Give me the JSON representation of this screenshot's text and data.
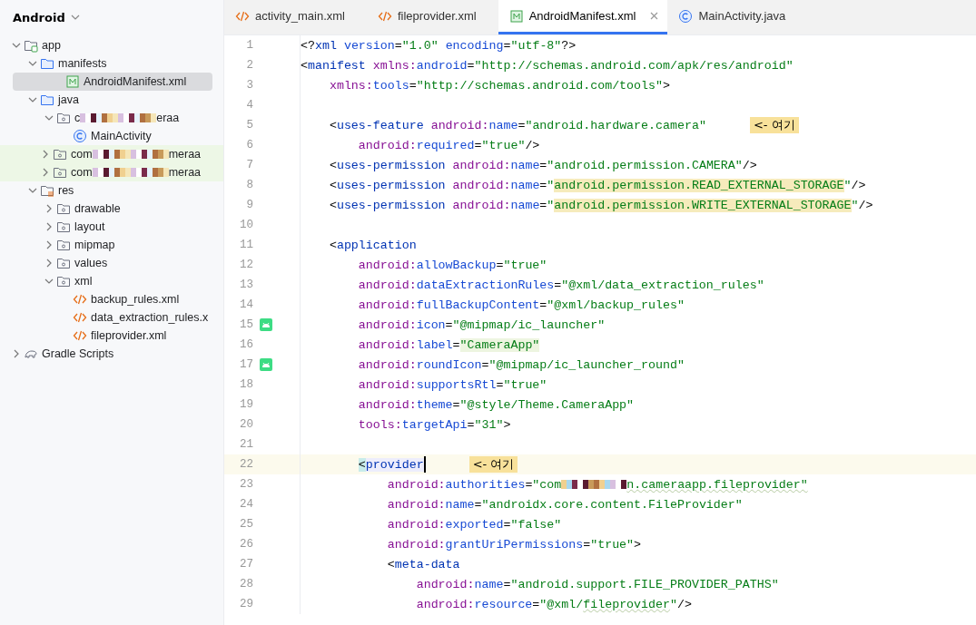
{
  "project_view": {
    "title": "Android",
    "tree": [
      {
        "kind": "module",
        "label": "app",
        "expanded": true,
        "selected": false,
        "highlighted": false,
        "children": [
          {
            "kind": "source-folder",
            "label": "manifests",
            "expanded": true,
            "selected": false,
            "highlighted": false,
            "children": [
              {
                "kind": "manifest",
                "label": "AndroidManifest.xml",
                "selected": true,
                "highlighted": false
              }
            ]
          },
          {
            "kind": "source-folder",
            "label": "java",
            "expanded": true,
            "selected": false,
            "highlighted": false,
            "children": [
              {
                "kind": "package",
                "label": "c",
                "label_end": "eraa",
                "redacted": true,
                "expanded": true,
                "selected": false,
                "highlighted": false,
                "children": [
                  {
                    "kind": "class",
                    "label": "MainActivity",
                    "selected": false,
                    "highlighted": false
                  }
                ]
              },
              {
                "kind": "package",
                "label": "com",
                "label_end": "meraa",
                "redacted": true,
                "expanded": false,
                "selected": false,
                "highlighted": true
              },
              {
                "kind": "package",
                "label": "com",
                "label_end": "meraa",
                "redacted": true,
                "expanded": false,
                "selected": false,
                "highlighted": true
              }
            ]
          },
          {
            "kind": "res-folder",
            "label": "res",
            "expanded": true,
            "selected": false,
            "highlighted": false,
            "children": [
              {
                "kind": "package",
                "label": "drawable",
                "expanded": false,
                "selected": false,
                "highlighted": false
              },
              {
                "kind": "package",
                "label": "layout",
                "expanded": false,
                "selected": false,
                "highlighted": false
              },
              {
                "kind": "package",
                "label": "mipmap",
                "expanded": false,
                "selected": false,
                "highlighted": false
              },
              {
                "kind": "package",
                "label": "values",
                "expanded": false,
                "selected": false,
                "highlighted": false
              },
              {
                "kind": "package",
                "label": "xml",
                "expanded": true,
                "selected": false,
                "highlighted": false,
                "children": [
                  {
                    "kind": "xml",
                    "label": "backup_rules.xml",
                    "selected": false,
                    "highlighted": false
                  },
                  {
                    "kind": "xml",
                    "label": "data_extraction_rules.x",
                    "selected": false,
                    "highlighted": false
                  },
                  {
                    "kind": "xml",
                    "label": "fileprovider.xml",
                    "selected": false,
                    "highlighted": false
                  }
                ]
              }
            ]
          }
        ]
      },
      {
        "kind": "gradle",
        "label": "Gradle Scripts",
        "expanded": false,
        "selected": false,
        "highlighted": false
      }
    ]
  },
  "tabs": [
    {
      "kind": "xml",
      "label": "activity_main.xml",
      "selected": false
    },
    {
      "kind": "xml",
      "label": "fileprovider.xml",
      "selected": false
    },
    {
      "kind": "manifest",
      "label": "AndroidManifest.xml",
      "selected": true
    },
    {
      "kind": "class",
      "label": "MainActivity.java",
      "selected": false
    }
  ],
  "editor": {
    "lines": [
      {
        "number": "1",
        "current": false,
        "segments": [
          {
            "kind": "punct",
            "t": "<?"
          },
          {
            "kind": "tag",
            "t": "xml"
          },
          {
            "kind": "attr",
            "t": " version"
          },
          {
            "kind": "punct",
            "t": "="
          },
          {
            "kind": "value",
            "t": "\"1.0\""
          },
          {
            "kind": "attr",
            "t": " encoding"
          },
          {
            "kind": "punct",
            "t": "="
          },
          {
            "kind": "value",
            "t": "\"utf-8\""
          },
          {
            "kind": "punct",
            "t": "?>"
          }
        ]
      },
      {
        "number": "2",
        "current": false,
        "segments": [
          {
            "kind": "punct",
            "t": "<"
          },
          {
            "kind": "tag",
            "t": "manifest"
          },
          {
            "kind": "prefix",
            "t": " xmlns:"
          },
          {
            "kind": "attr",
            "t": "android"
          },
          {
            "kind": "punct",
            "t": "="
          },
          {
            "kind": "value",
            "t": "\"http://schemas.android.com/apk/res/android\""
          }
        ]
      },
      {
        "number": "3",
        "current": false,
        "segments": [
          {
            "kind": "prefix",
            "t": "    xmlns:"
          },
          {
            "kind": "attr",
            "t": "tools"
          },
          {
            "kind": "punct",
            "t": "="
          },
          {
            "kind": "value",
            "t": "\"http://schemas.android.com/tools\""
          },
          {
            "kind": "punct",
            "t": ">"
          }
        ]
      },
      {
        "number": "4",
        "current": false
      },
      {
        "number": "5",
        "current": false,
        "note": "<- 여기",
        "segments": [
          {
            "kind": "punct",
            "t": "    <"
          },
          {
            "kind": "tag",
            "t": "uses-feature"
          },
          {
            "kind": "prefix",
            "t": " android:"
          },
          {
            "kind": "attr",
            "t": "name"
          },
          {
            "kind": "punct",
            "t": "="
          },
          {
            "kind": "value",
            "t": "\"android.hardware.camera\""
          }
        ]
      },
      {
        "number": "6",
        "current": false,
        "segments": [
          {
            "kind": "prefix",
            "t": "        android:"
          },
          {
            "kind": "attr",
            "t": "required"
          },
          {
            "kind": "punct",
            "t": "="
          },
          {
            "kind": "value",
            "t": "\"true\""
          },
          {
            "kind": "punct",
            "t": "/>"
          }
        ]
      },
      {
        "number": "7",
        "current": false,
        "segments": [
          {
            "kind": "punct",
            "t": "    <"
          },
          {
            "kind": "tag",
            "t": "uses-permission"
          },
          {
            "kind": "prefix",
            "t": " android:"
          },
          {
            "kind": "attr",
            "t": "name"
          },
          {
            "kind": "punct",
            "t": "="
          },
          {
            "kind": "value",
            "t": "\"android.permission.CAMERA\""
          },
          {
            "kind": "punct",
            "t": "/>"
          }
        ]
      },
      {
        "number": "8",
        "current": false,
        "segments": [
          {
            "kind": "punct",
            "t": "    <"
          },
          {
            "kind": "tag",
            "t": "uses-permission"
          },
          {
            "kind": "prefix",
            "t": " android:"
          },
          {
            "kind": "attr",
            "t": "name"
          },
          {
            "kind": "punct",
            "t": "="
          },
          {
            "kind": "value",
            "t": "\""
          },
          {
            "kind": "value",
            "t": "android.permission.READ_EXTERNAL_STORAGE",
            "warning": true
          },
          {
            "kind": "value",
            "t": "\""
          },
          {
            "kind": "punct",
            "t": "/>"
          }
        ]
      },
      {
        "number": "9",
        "current": false,
        "segments": [
          {
            "kind": "punct",
            "t": "    <"
          },
          {
            "kind": "tag",
            "t": "uses-permission"
          },
          {
            "kind": "prefix",
            "t": " android:"
          },
          {
            "kind": "attr",
            "t": "name"
          },
          {
            "kind": "punct",
            "t": "="
          },
          {
            "kind": "value",
            "t": "\""
          },
          {
            "kind": "value",
            "t": "android.permission.WRITE_EXTERNAL_STORAGE",
            "warning": true
          },
          {
            "kind": "value",
            "t": "\""
          },
          {
            "kind": "punct",
            "t": "/>"
          }
        ]
      },
      {
        "number": "10",
        "current": false
      },
      {
        "number": "11",
        "current": false,
        "segments": [
          {
            "kind": "punct",
            "t": "    <"
          },
          {
            "kind": "tag",
            "t": "application"
          }
        ]
      },
      {
        "number": "12",
        "current": false,
        "segments": [
          {
            "kind": "prefix",
            "t": "        android:"
          },
          {
            "kind": "attr",
            "t": "allowBackup"
          },
          {
            "kind": "punct",
            "t": "="
          },
          {
            "kind": "value",
            "t": "\"true\""
          }
        ]
      },
      {
        "number": "13",
        "current": false,
        "segments": [
          {
            "kind": "prefix",
            "t": "        android:"
          },
          {
            "kind": "attr",
            "t": "dataExtractionRules"
          },
          {
            "kind": "punct",
            "t": "="
          },
          {
            "kind": "value",
            "t": "\"@xml/data_extraction_rules\""
          }
        ]
      },
      {
        "number": "14",
        "current": false,
        "segments": [
          {
            "kind": "prefix",
            "t": "        android:"
          },
          {
            "kind": "attr",
            "t": "fullBackupContent"
          },
          {
            "kind": "punct",
            "t": "="
          },
          {
            "kind": "value",
            "t": "\"@xml/backup_rules\""
          }
        ]
      },
      {
        "number": "15",
        "current": false,
        "android_icon": true,
        "segments": [
          {
            "kind": "prefix",
            "t": "        android:"
          },
          {
            "kind": "attr",
            "t": "icon"
          },
          {
            "kind": "punct",
            "t": "="
          },
          {
            "kind": "value",
            "t": "\"@mipmap/ic_launcher\""
          }
        ]
      },
      {
        "number": "16",
        "current": false,
        "segments": [
          {
            "kind": "prefix",
            "t": "        android:"
          },
          {
            "kind": "attr",
            "t": "label"
          },
          {
            "kind": "punct",
            "t": "="
          },
          {
            "kind": "value",
            "t": "\"CameraApp\"",
            "usage_highlight": true
          }
        ]
      },
      {
        "number": "17",
        "current": false,
        "android_icon": true,
        "segments": [
          {
            "kind": "prefix",
            "t": "        android:"
          },
          {
            "kind": "attr",
            "t": "roundIcon"
          },
          {
            "kind": "punct",
            "t": "="
          },
          {
            "kind": "value",
            "t": "\"@mipmap/ic_launcher_round\""
          }
        ]
      },
      {
        "number": "18",
        "current": false,
        "segments": [
          {
            "kind": "prefix",
            "t": "        android:"
          },
          {
            "kind": "attr",
            "t": "supportsRtl"
          },
          {
            "kind": "punct",
            "t": "="
          },
          {
            "kind": "value",
            "t": "\"true\""
          }
        ]
      },
      {
        "number": "19",
        "current": false,
        "segments": [
          {
            "kind": "prefix",
            "t": "        android:"
          },
          {
            "kind": "attr",
            "t": "theme"
          },
          {
            "kind": "punct",
            "t": "="
          },
          {
            "kind": "value",
            "t": "\"@style/Theme.CameraApp\""
          }
        ]
      },
      {
        "number": "20",
        "current": false,
        "segments": [
          {
            "kind": "prefix",
            "t": "        tools:"
          },
          {
            "kind": "attr",
            "t": "targetApi"
          },
          {
            "kind": "punct",
            "t": "="
          },
          {
            "kind": "value",
            "t": "\"31\""
          },
          {
            "kind": "punct",
            "t": ">"
          }
        ]
      },
      {
        "number": "21",
        "current": false
      },
      {
        "number": "22",
        "current": true,
        "note": "<- 여기",
        "segments": [
          {
            "kind": "punct",
            "t": "        <",
            "brace_match": true
          },
          {
            "kind": "tag",
            "t": "provider",
            "tag_match": true
          }
        ]
      },
      {
        "number": "23",
        "current": false,
        "segments": [
          {
            "kind": "prefix",
            "t": "            android:"
          },
          {
            "kind": "attr",
            "t": "authorities"
          },
          {
            "kind": "punct",
            "t": "="
          },
          {
            "kind": "value",
            "t": "\"com"
          },
          {
            "kind": "redacted"
          },
          {
            "kind": "value",
            "t": "n.cameraapp.fileprovider\"",
            "squiggle": true
          }
        ]
      },
      {
        "number": "24",
        "current": false,
        "segments": [
          {
            "kind": "prefix",
            "t": "            android:"
          },
          {
            "kind": "attr",
            "t": "name"
          },
          {
            "kind": "punct",
            "t": "="
          },
          {
            "kind": "value",
            "t": "\"androidx.core.content.FileProvider\""
          }
        ]
      },
      {
        "number": "25",
        "current": false,
        "segments": [
          {
            "kind": "prefix",
            "t": "            android:"
          },
          {
            "kind": "attr",
            "t": "exported"
          },
          {
            "kind": "punct",
            "t": "="
          },
          {
            "kind": "value",
            "t": "\"false\""
          }
        ]
      },
      {
        "number": "26",
        "current": false,
        "segments": [
          {
            "kind": "prefix",
            "t": "            android:"
          },
          {
            "kind": "attr",
            "t": "grantUriPermissions"
          },
          {
            "kind": "punct",
            "t": "="
          },
          {
            "kind": "value",
            "t": "\"true\""
          },
          {
            "kind": "punct",
            "t": ">"
          }
        ]
      },
      {
        "number": "27",
        "current": false,
        "segments": [
          {
            "kind": "punct",
            "t": "            <"
          },
          {
            "kind": "tag",
            "t": "meta-data"
          }
        ]
      },
      {
        "number": "28",
        "current": false,
        "segments": [
          {
            "kind": "prefix",
            "t": "                android:"
          },
          {
            "kind": "attr",
            "t": "name"
          },
          {
            "kind": "punct",
            "t": "="
          },
          {
            "kind": "value",
            "t": "\"android.support.FILE_PROVIDER_PATHS\""
          }
        ]
      },
      {
        "number": "29",
        "current": false,
        "segments": [
          {
            "kind": "prefix",
            "t": "                android:"
          },
          {
            "kind": "attr",
            "t": "resource"
          },
          {
            "kind": "punct",
            "t": "="
          },
          {
            "kind": "value",
            "t": "\"@xml/"
          },
          {
            "kind": "value",
            "t": "fileprovider",
            "squiggle": true
          },
          {
            "kind": "value",
            "t": "\""
          },
          {
            "kind": "punct",
            "t": "/>"
          }
        ]
      }
    ]
  }
}
